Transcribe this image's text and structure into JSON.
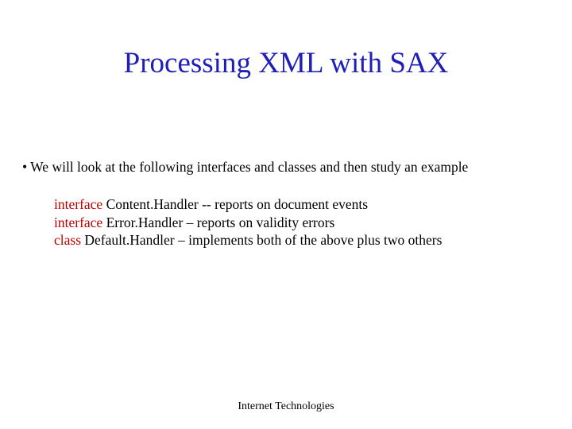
{
  "title": "Processing XML with SAX",
  "bullet": {
    "text": "• We will look at the following interfaces and classes and  then study an example"
  },
  "items": [
    {
      "keyword": "interface",
      "rest": " Content.Handler  -- reports on document events"
    },
    {
      "keyword": "interface",
      "rest": " Error.Handler – reports on validity errors"
    },
    {
      "keyword": "class",
      "rest": "  Default.Handler – implements both of the above plus two others"
    }
  ],
  "footer": "Internet Technologies"
}
